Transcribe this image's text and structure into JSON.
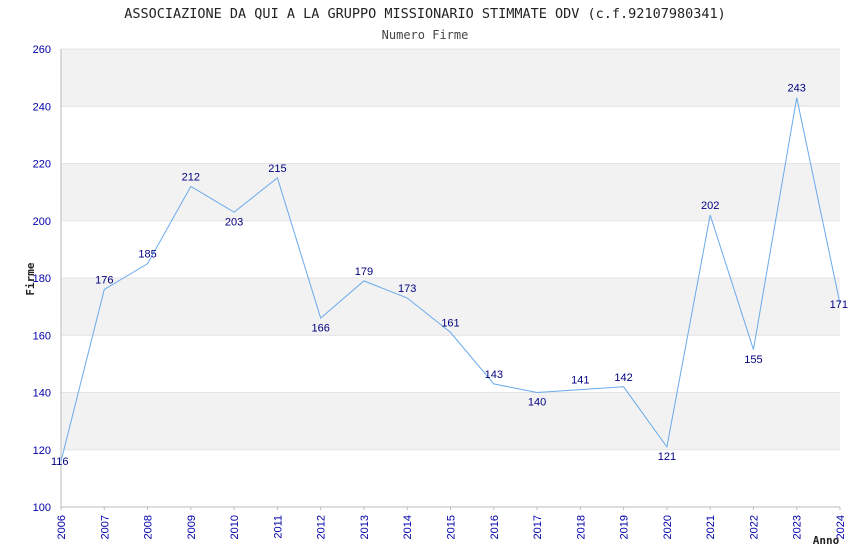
{
  "chart_data": {
    "type": "line",
    "title": "ASSOCIAZIONE DA QUI A LA GRUPPO MISSIONARIO STIMMATE ODV (c.f.92107980341)",
    "subtitle": "Numero Firme",
    "xlabel": "Anno",
    "ylabel": "Firme",
    "ylim": [
      100,
      260
    ],
    "yticks": [
      100,
      120,
      140,
      160,
      180,
      200,
      220,
      240,
      260
    ],
    "x": [
      2006,
      2007,
      2008,
      2009,
      2010,
      2011,
      2012,
      2013,
      2014,
      2015,
      2016,
      2017,
      2018,
      2019,
      2020,
      2021,
      2022,
      2023,
      2024
    ],
    "values": [
      116,
      176,
      185,
      212,
      203,
      215,
      166,
      179,
      173,
      161,
      143,
      140,
      141,
      142,
      121,
      202,
      155,
      243,
      171
    ],
    "grid": "horizontal bands",
    "colors": {
      "line": "#6aaaea",
      "band": "#f2f2f2",
      "tick_text": "#0000aa",
      "label_text": "#000080"
    }
  }
}
